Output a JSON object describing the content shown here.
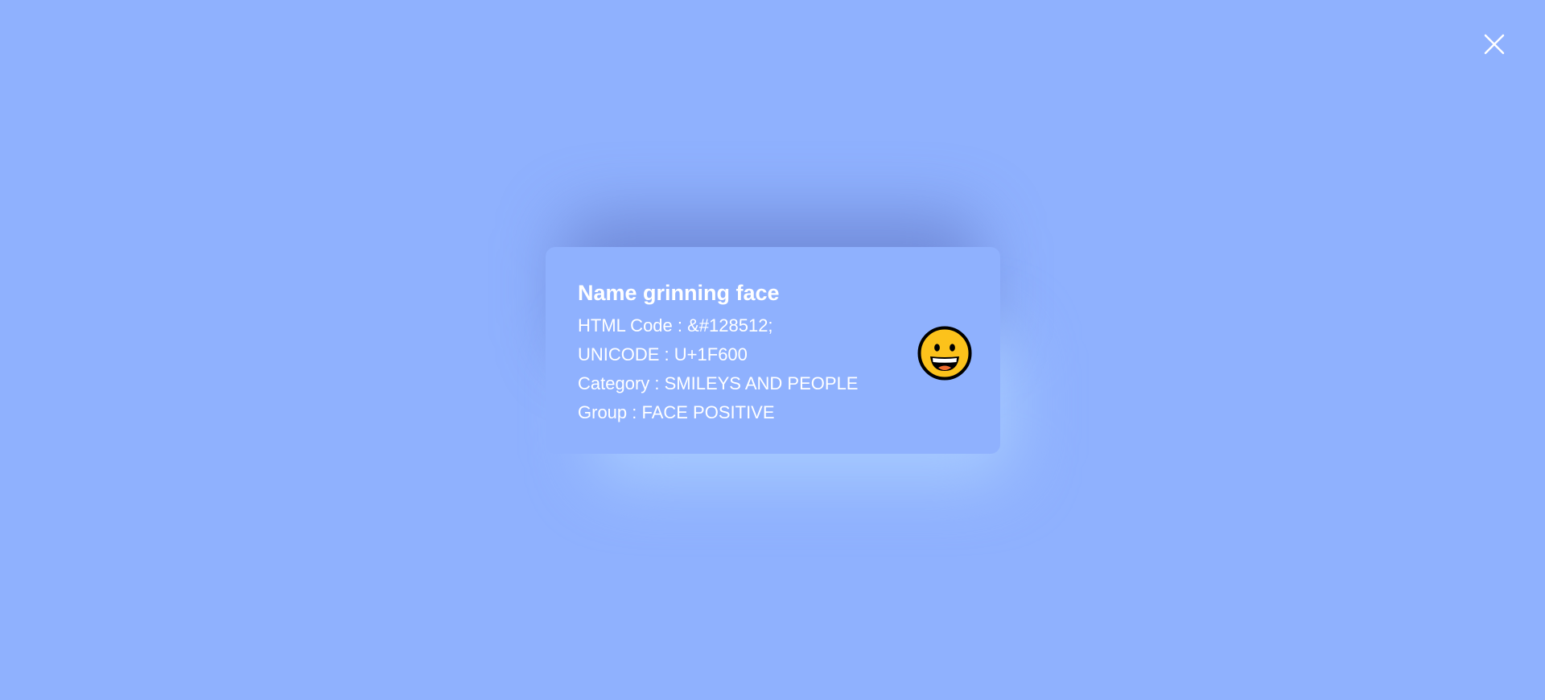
{
  "close": {
    "icon": "close-icon"
  },
  "emoji": {
    "title": "Name grinning face",
    "html_code": "HTML Code : &#128512;",
    "unicode": "UNICODE : U+1F600",
    "category": "Category : SMILEYS AND PEOPLE",
    "group": "Group : FACE POSITIVE",
    "icon": "grinning-face-icon"
  },
  "colors": {
    "background": "#8fb1fe",
    "text": "#ffffff",
    "emoji_face": "#fcc21b"
  }
}
